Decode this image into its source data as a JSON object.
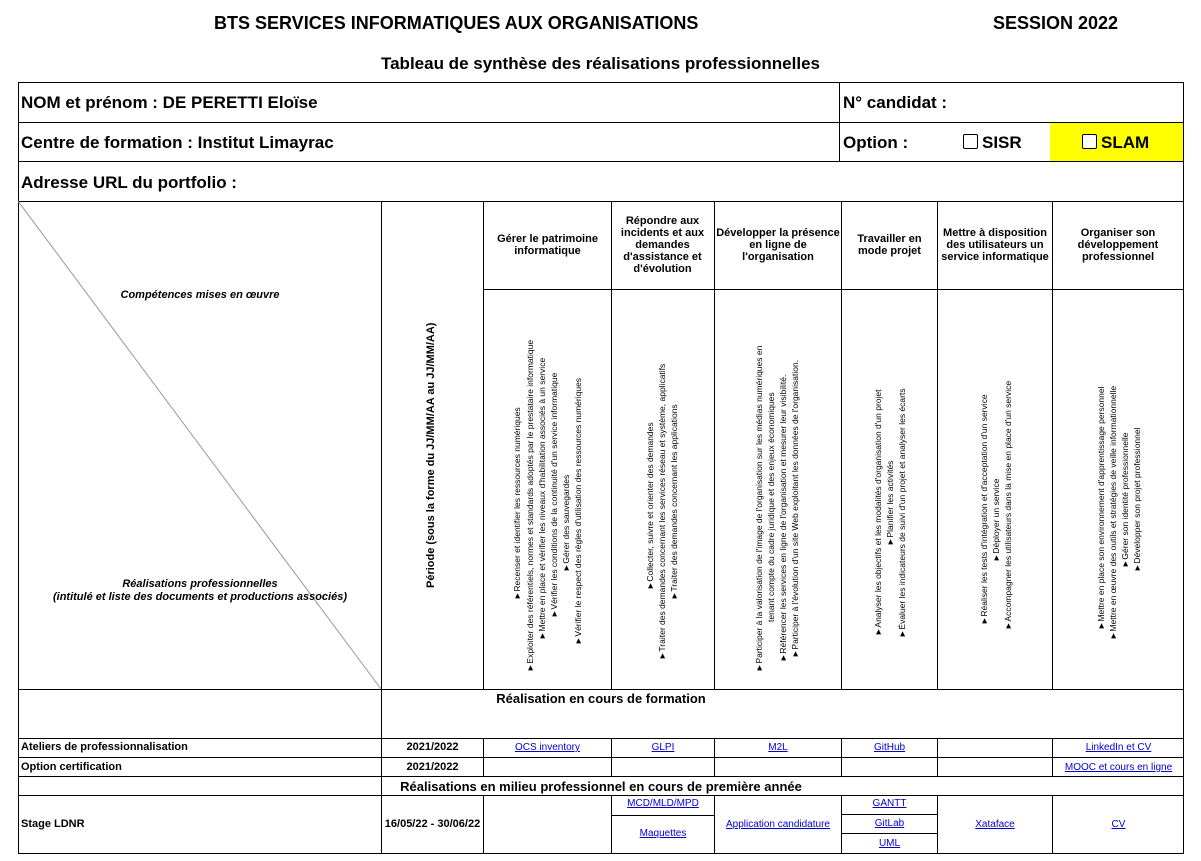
{
  "header": {
    "title": "BTS SERVICES INFORMATIQUES AUX ORGANISATIONS",
    "session": "SESSION 2022",
    "subtitle": "Tableau de synthèse des réalisations professionnelles"
  },
  "identity": {
    "name": "NOM et prénom : DE PERETTI Eloïse",
    "candidate_no": "N° candidat :",
    "center": "Centre de formation : Institut Limayrac",
    "option_label": "Option :",
    "option_sisr": "SISR",
    "option_slam": "SLAM",
    "portfolio_url": "Adresse URL du portfolio :",
    "highlight_color": "#ffff00"
  },
  "table_head": {
    "competences": "Compétences mises en œuvre",
    "realisations": "Réalisations professionnelles",
    "realisations_sub": "(intitulé et liste des documents et productions associés)",
    "period": "Période (sous la forme du JJ/MM/AA au JJ/MM/AA)",
    "columns": [
      {
        "title": "Gérer le patrimoine informatique",
        "items": [
          "►Recenser et identifier les ressources numériques",
          "►Exploiter des référentiels, normes et standards adoptés par le prestataire informatique",
          "►Mettre en place et vérifier les niveaux d'habilitation associés à un service",
          "►Vérifier les conditions de la continuité d'un service informatique",
          "►Gérer des sauvegardes",
          "►Vérifier le respect des règles d'utilisation des ressources numériques"
        ]
      },
      {
        "title": "Répondre aux incidents et aux demandes d'assistance et d'évolution",
        "items": [
          "►Collecter, suivre et orienter des demandes",
          "►Traiter des demandes concernant les services réseau et système, applicatifs",
          "►Traiter des demandes concernant les applications"
        ]
      },
      {
        "title": "Développer la présence en ligne de l'organisation",
        "items": [
          "►Participer à la valorisation de l'image de l'organisation sur les médias numériques en",
          "tenant compte du cadre juridique et des enjeux économiques",
          "►Référencer les services en ligne de l'organisation et mesurer leur visibilité.",
          "►Participer à l'évolution d'un site Web exploitant les données de l'organisation."
        ]
      },
      {
        "title": "Travailler en mode projet",
        "items": [
          "►Analyser les objectifs et les modalités d'organisation d'un projet",
          "►Planifier les activités",
          "►Évaluer les indicateurs de suivi d'un projet et analyser les écarts"
        ]
      },
      {
        "title": "Mettre à disposition des utilisateurs un service informatique",
        "items": [
          "►Réaliser les tests d'intégration et d'acceptation d'un service",
          "►Déployer un service",
          "►Accompagner les utilisateurs dans la mise en place d'un service"
        ]
      },
      {
        "title": "Organiser son développement professionnel",
        "items": [
          "►Mettre en place son environnement d'apprentissage personnel",
          "►Mettre en œuvre des outils et stratégies de veille informationnelle",
          "►Gérer son identité professionnelle",
          "►Développer son projet professionnel"
        ]
      }
    ]
  },
  "sections": {
    "training": "Réalisation en cours de formation",
    "professional": "Réalisations en milieu professionnel en cours de première année"
  },
  "rows": {
    "ateliers": {
      "label": "Ateliers de professionnalisation",
      "period": "2021/2022",
      "c1": "OCS inventory",
      "c2": "GLPI",
      "c3": "M2L",
      "c4": "GitHub",
      "c6": "LinkedIn et CV"
    },
    "certification": {
      "label": "Option certification",
      "period": "2021/2022",
      "c6": "MOOC et cours en ligne"
    },
    "stage": {
      "label": "Stage LDNR",
      "period": "16/05/22 - 30/06/22",
      "c2a": "MCD/MLD/MPD",
      "c2b": "Maquettes",
      "c3": "Application candidature",
      "c4a": "GANTT",
      "c4b": "GitLab",
      "c4c": "UML",
      "c5": "Xataface",
      "c6": "CV"
    }
  }
}
